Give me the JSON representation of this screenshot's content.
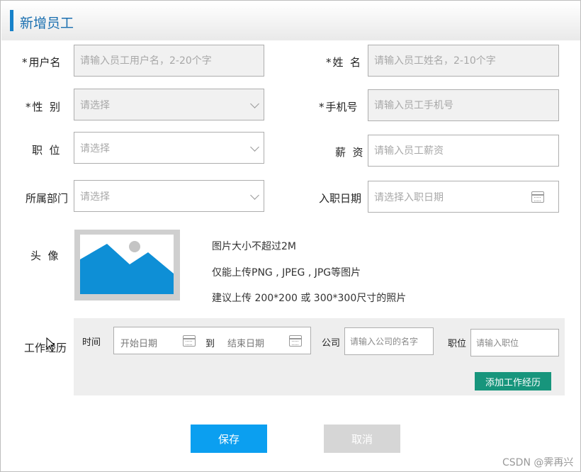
{
  "dialog": {
    "title": "新增员工"
  },
  "form": {
    "username": {
      "label": "用户名",
      "placeholder": "请输入员工用户名，2-20个字"
    },
    "name": {
      "label": "姓  名",
      "placeholder": "请输入员工姓名，2-10个字"
    },
    "gender": {
      "label": "性  别",
      "placeholder": "请选择"
    },
    "phone": {
      "label": "手机号",
      "placeholder": "请输入员工手机号"
    },
    "position": {
      "label": "职  位",
      "placeholder": "请选择"
    },
    "salary": {
      "label": "薪  资",
      "placeholder": "请输入员工薪资"
    },
    "department": {
      "label": "所属部门",
      "placeholder": "请选择"
    },
    "hire_date": {
      "label": "入职日期",
      "placeholder": "请选择入职日期"
    },
    "avatar": {
      "label": "头  像",
      "hints": [
        "图片大小不超过2M",
        "仅能上传PNG , JPEG , JPG等图片",
        "建议上传 200*200 或 300*300尺寸的照片"
      ]
    },
    "work_history": {
      "label": "工作经历",
      "time_label": "时间",
      "start_placeholder": "开始日期",
      "to_label": "到",
      "end_placeholder": "结束日期",
      "company_label": "公司",
      "company_placeholder": "请输入公司的名字",
      "job_label": "职位",
      "job_placeholder": "请输入职位",
      "add_button": "添加工作经历"
    }
  },
  "actions": {
    "save": "保存",
    "cancel": "取消"
  },
  "watermark": "CSDN @霁再兴",
  "colors": {
    "accent": "#1781c9",
    "primary_button": "#0b9ff0",
    "add_button": "#17957c",
    "disabled_button": "#d6d6d6"
  }
}
